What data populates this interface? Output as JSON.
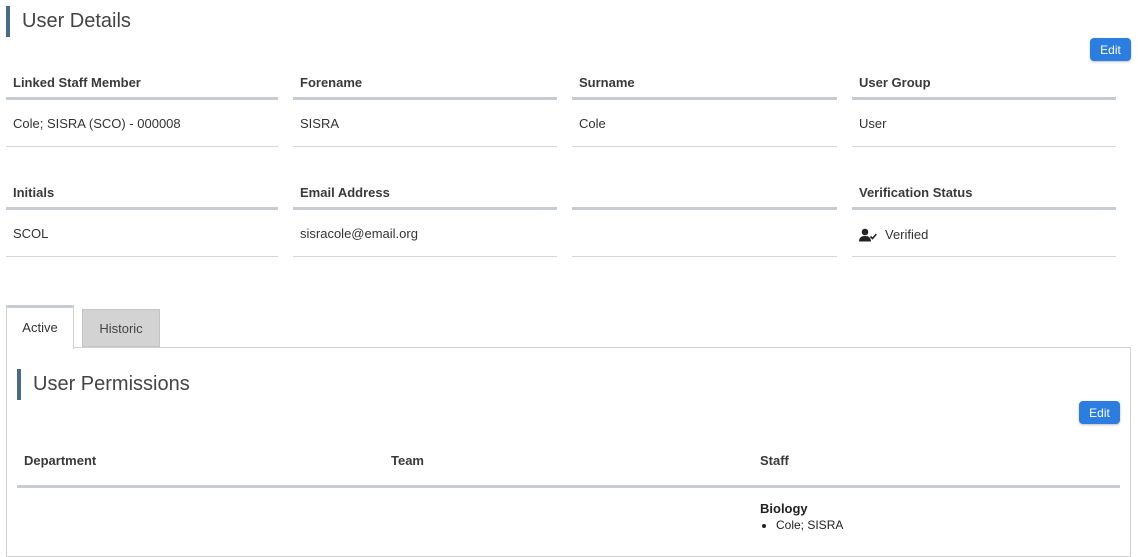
{
  "user_details": {
    "title": "User Details",
    "edit_label": "Edit",
    "fields": {
      "linked_staff": {
        "label": "Linked Staff Member",
        "value": "Cole; SISRA (SCO) - 000008"
      },
      "forename": {
        "label": "Forename",
        "value": "SISRA"
      },
      "surname": {
        "label": "Surname",
        "value": "Cole"
      },
      "user_group": {
        "label": "User Group",
        "value": "User"
      },
      "initials": {
        "label": "Initials",
        "value": "SCOL"
      },
      "email": {
        "label": "Email Address",
        "value": "sisracole@email.org"
      },
      "blank": {
        "label": "",
        "value": ""
      },
      "verification": {
        "label": "Verification Status",
        "value": "Verified",
        "icon": "user-check-icon"
      }
    }
  },
  "tabs": {
    "active": "Active",
    "historic": "Historic"
  },
  "permissions": {
    "title": "User Permissions",
    "edit_label": "Edit",
    "columns": {
      "department": "Department",
      "team": "Team",
      "staff": "Staff"
    },
    "rows": [
      {
        "department": "",
        "team": "",
        "staff_group": "Biology",
        "staff_members": [
          "Cole; SISRA"
        ]
      }
    ]
  },
  "colors": {
    "accent_bar": "#4a6a8c",
    "button": "#2b7de0",
    "inactive_tab": "#d3d3d3"
  }
}
